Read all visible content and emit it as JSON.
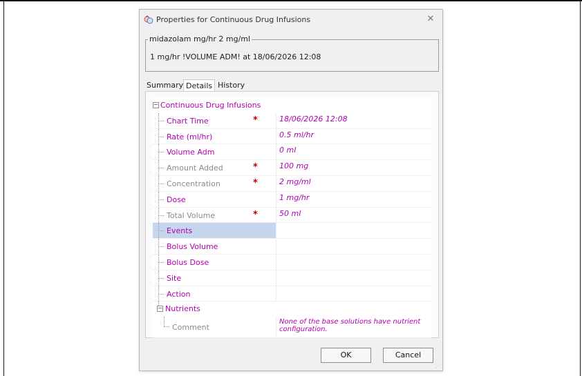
{
  "window": {
    "title": "Properties for Continuous Drug Infusions",
    "close_glyph": "✕"
  },
  "order": {
    "legend": "midazolam mg/hr 2 mg/ml",
    "summary": "1 mg/hr !VOLUME ADM! at 18/06/2026 12:08"
  },
  "tabs": [
    {
      "label": "Summary"
    },
    {
      "label": "Details"
    },
    {
      "label": "History"
    }
  ],
  "grid": {
    "group_label": "Continuous Drug Infusions",
    "rows": [
      {
        "name": "Chart Time",
        "value": "18/06/2026 12:08"
      },
      {
        "name": "Rate (ml/hr)",
        "value": "0.5 ml/hr"
      },
      {
        "name": "Volume Adm",
        "value": "0 ml"
      },
      {
        "name": "Amount Added",
        "value": "100 mg"
      },
      {
        "name": "Concentration",
        "value": "2 mg/ml"
      },
      {
        "name": "Dose",
        "value": "1 mg/hr"
      },
      {
        "name": "Total Volume",
        "value": "50 ml"
      },
      {
        "name": "Events",
        "value": ""
      },
      {
        "name": "Bolus Volume",
        "value": ""
      },
      {
        "name": "Bolus Dose",
        "value": ""
      },
      {
        "name": "Site",
        "value": ""
      },
      {
        "name": "Action",
        "value": ""
      }
    ],
    "subgroup_label": "Nutrients",
    "comment": {
      "name": "Comment",
      "value": "None of the base solutions have nutrient configuration."
    },
    "required_mark": "*",
    "expander_glyph": "−"
  },
  "buttons": {
    "ok": "OK",
    "cancel": "Cancel"
  },
  "colors": {
    "value_text": "#b000b0",
    "required": "#c00000",
    "selection": "#c6d6ee"
  }
}
